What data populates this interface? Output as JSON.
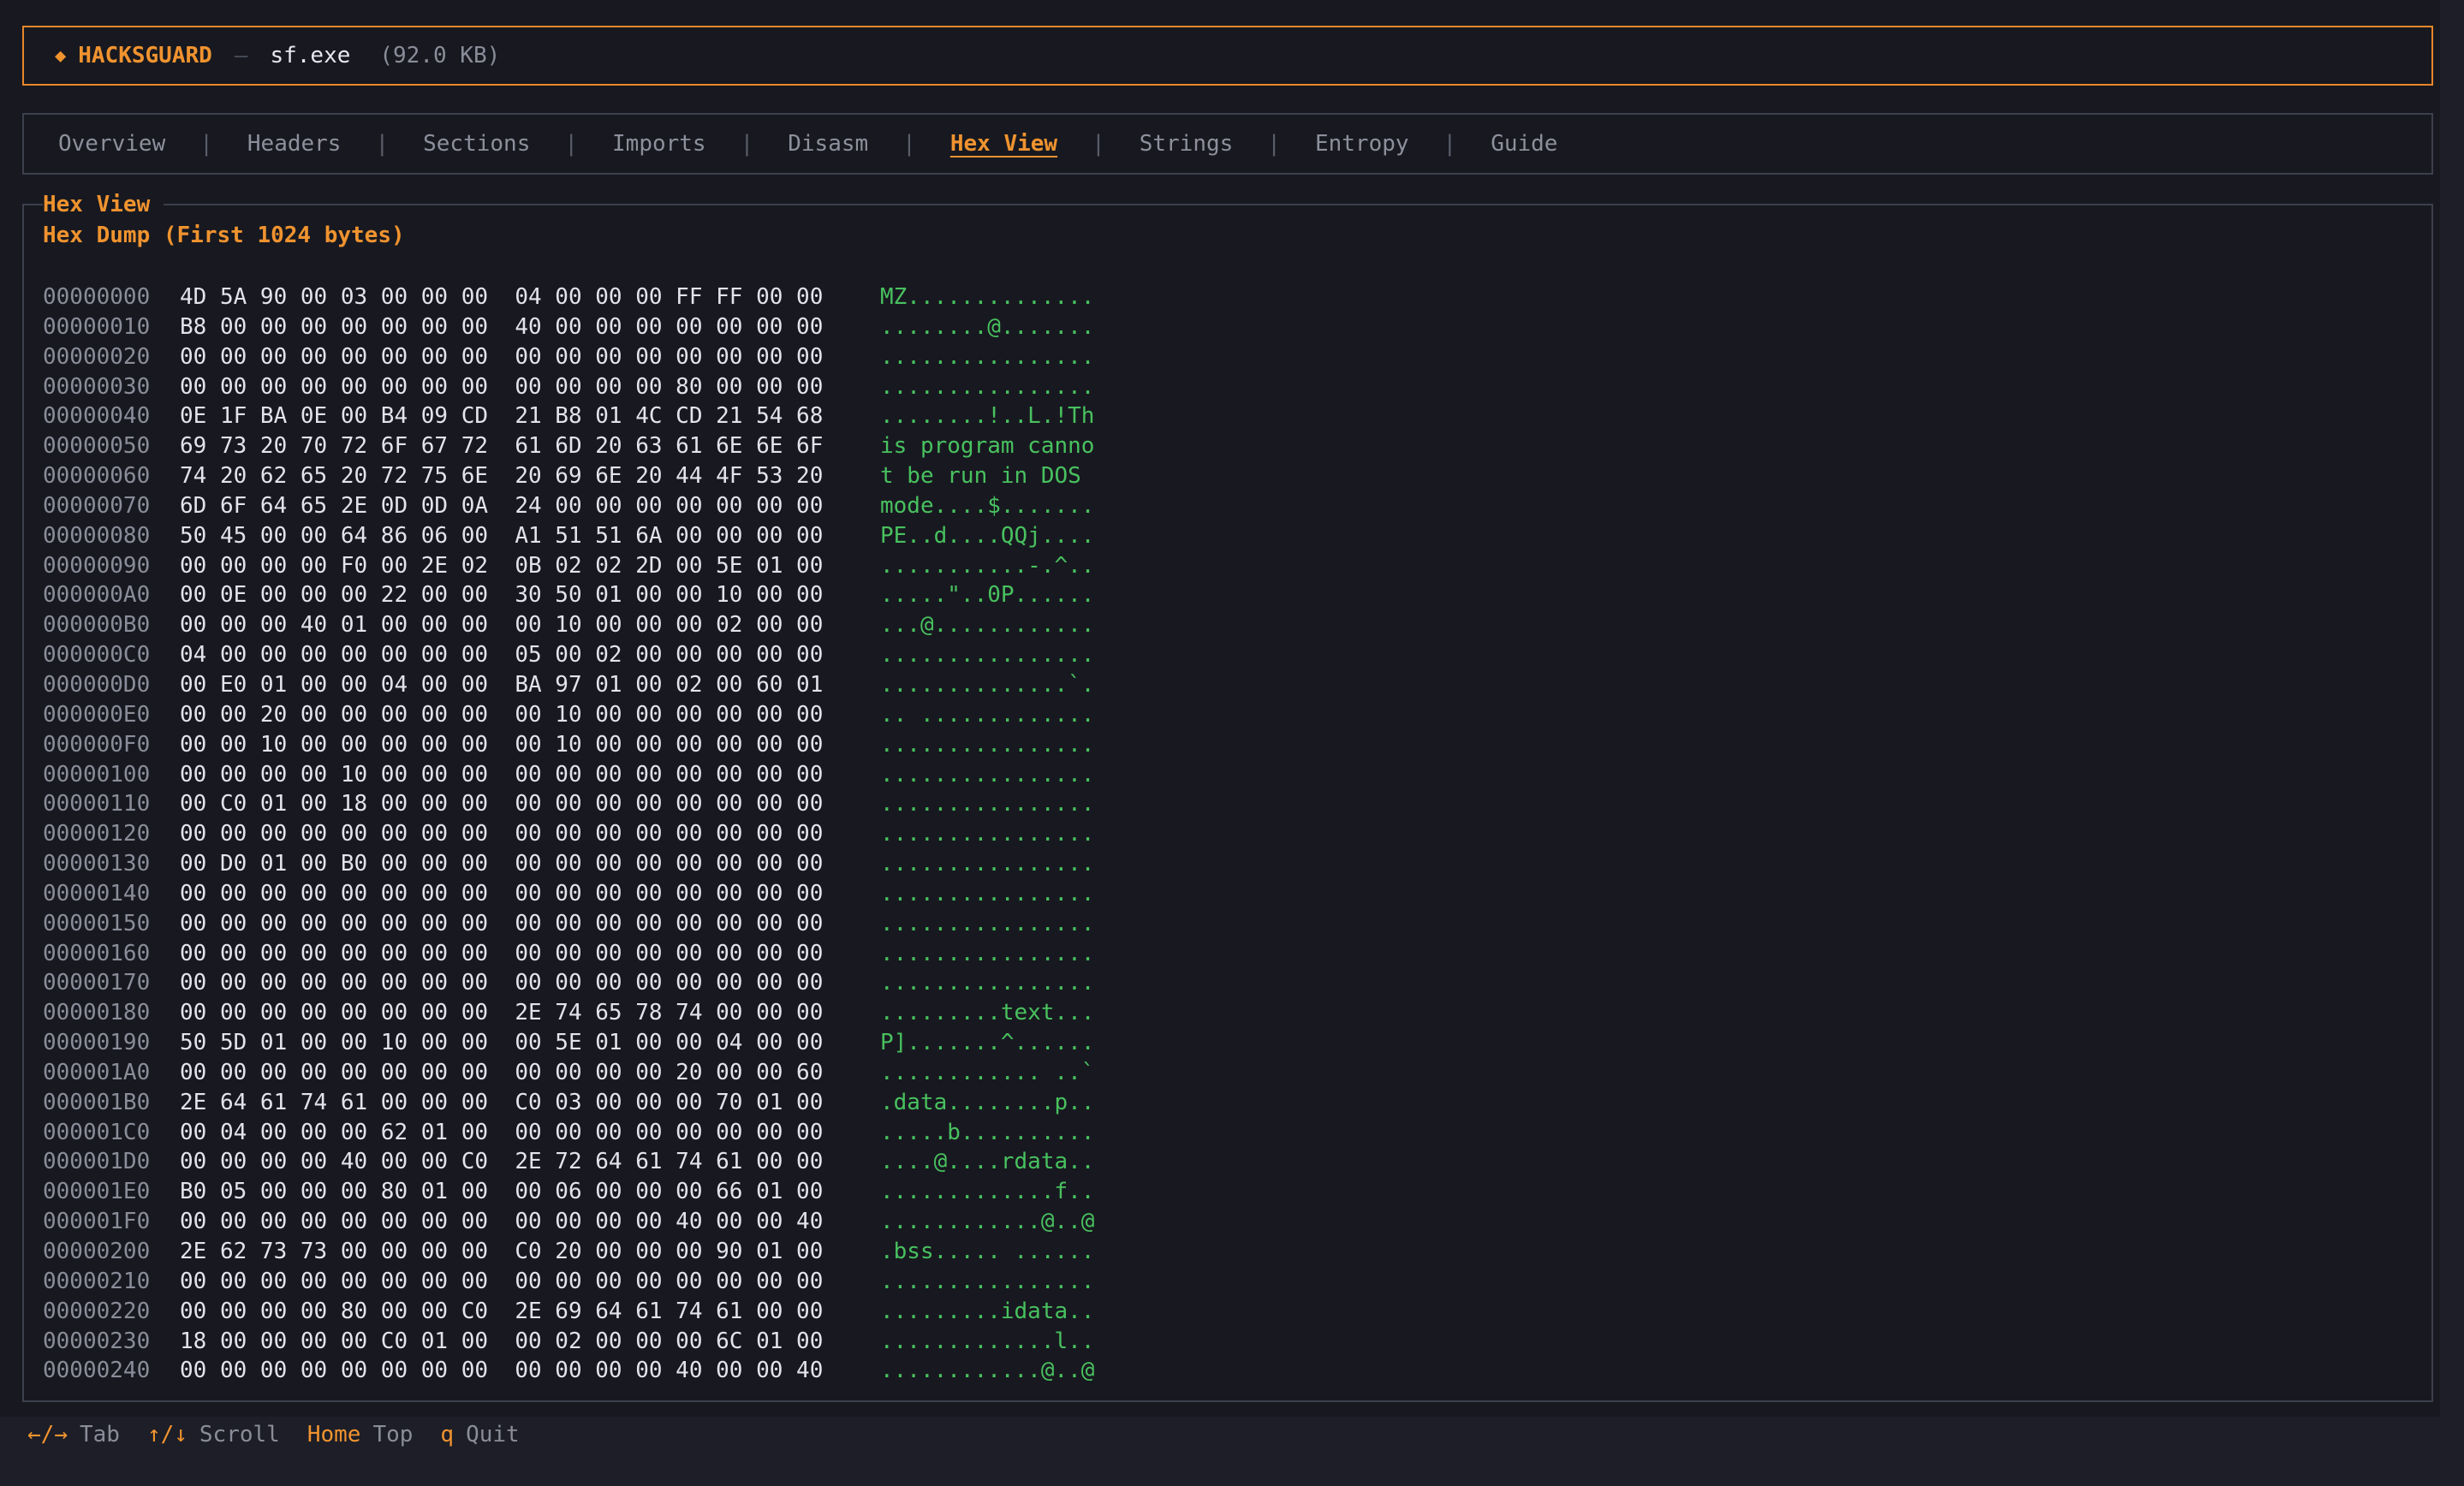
{
  "header": {
    "brand": "HACKSGUARD",
    "separator": "—",
    "filename": "sf.exe",
    "filesize": "(92.0 KB)"
  },
  "tabs": [
    {
      "id": "overview",
      "label": "Overview",
      "active": false
    },
    {
      "id": "headers",
      "label": "Headers",
      "active": false
    },
    {
      "id": "sections",
      "label": "Sections",
      "active": false
    },
    {
      "id": "imports",
      "label": "Imports",
      "active": false
    },
    {
      "id": "disasm",
      "label": "Disasm",
      "active": false
    },
    {
      "id": "hexview",
      "label": "Hex View",
      "active": true
    },
    {
      "id": "strings",
      "label": "Strings",
      "active": false
    },
    {
      "id": "entropy",
      "label": "Entropy",
      "active": false
    },
    {
      "id": "guide",
      "label": "Guide",
      "active": false
    }
  ],
  "content": {
    "legend": "Hex View",
    "subtitle": "Hex Dump (First 1024 bytes)"
  },
  "hex_rows": [
    {
      "offset": "00000000",
      "hex": "4D 5A 90 00 03 00 00 00  04 00 00 00 FF FF 00 00",
      "ascii": "MZ.............."
    },
    {
      "offset": "00000010",
      "hex": "B8 00 00 00 00 00 00 00  40 00 00 00 00 00 00 00",
      "ascii": "........@......."
    },
    {
      "offset": "00000020",
      "hex": "00 00 00 00 00 00 00 00  00 00 00 00 00 00 00 00",
      "ascii": "................"
    },
    {
      "offset": "00000030",
      "hex": "00 00 00 00 00 00 00 00  00 00 00 00 80 00 00 00",
      "ascii": "................"
    },
    {
      "offset": "00000040",
      "hex": "0E 1F BA 0E 00 B4 09 CD  21 B8 01 4C CD 21 54 68",
      "ascii": "........!..L.!Th"
    },
    {
      "offset": "00000050",
      "hex": "69 73 20 70 72 6F 67 72  61 6D 20 63 61 6E 6E 6F",
      "ascii": "is program canno"
    },
    {
      "offset": "00000060",
      "hex": "74 20 62 65 20 72 75 6E  20 69 6E 20 44 4F 53 20",
      "ascii": "t be run in DOS "
    },
    {
      "offset": "00000070",
      "hex": "6D 6F 64 65 2E 0D 0D 0A  24 00 00 00 00 00 00 00",
      "ascii": "mode....$......."
    },
    {
      "offset": "00000080",
      "hex": "50 45 00 00 64 86 06 00  A1 51 51 6A 00 00 00 00",
      "ascii": "PE..d....QQj...."
    },
    {
      "offset": "00000090",
      "hex": "00 00 00 00 F0 00 2E 02  0B 02 02 2D 00 5E 01 00",
      "ascii": "...........-.^.."
    },
    {
      "offset": "000000A0",
      "hex": "00 0E 00 00 00 22 00 00  30 50 01 00 00 10 00 00",
      "ascii": ".....\"..0P......"
    },
    {
      "offset": "000000B0",
      "hex": "00 00 00 40 01 00 00 00  00 10 00 00 00 02 00 00",
      "ascii": "...@............"
    },
    {
      "offset": "000000C0",
      "hex": "04 00 00 00 00 00 00 00  05 00 02 00 00 00 00 00",
      "ascii": "................"
    },
    {
      "offset": "000000D0",
      "hex": "00 E0 01 00 00 04 00 00  BA 97 01 00 02 00 60 01",
      "ascii": "..............`."
    },
    {
      "offset": "000000E0",
      "hex": "00 00 20 00 00 00 00 00  00 10 00 00 00 00 00 00",
      "ascii": ".. ............."
    },
    {
      "offset": "000000F0",
      "hex": "00 00 10 00 00 00 00 00  00 10 00 00 00 00 00 00",
      "ascii": "................"
    },
    {
      "offset": "00000100",
      "hex": "00 00 00 00 10 00 00 00  00 00 00 00 00 00 00 00",
      "ascii": "................"
    },
    {
      "offset": "00000110",
      "hex": "00 C0 01 00 18 00 00 00  00 00 00 00 00 00 00 00",
      "ascii": "................"
    },
    {
      "offset": "00000120",
      "hex": "00 00 00 00 00 00 00 00  00 00 00 00 00 00 00 00",
      "ascii": "................"
    },
    {
      "offset": "00000130",
      "hex": "00 D0 01 00 B0 00 00 00  00 00 00 00 00 00 00 00",
      "ascii": "................"
    },
    {
      "offset": "00000140",
      "hex": "00 00 00 00 00 00 00 00  00 00 00 00 00 00 00 00",
      "ascii": "................"
    },
    {
      "offset": "00000150",
      "hex": "00 00 00 00 00 00 00 00  00 00 00 00 00 00 00 00",
      "ascii": "................"
    },
    {
      "offset": "00000160",
      "hex": "00 00 00 00 00 00 00 00  00 00 00 00 00 00 00 00",
      "ascii": "................"
    },
    {
      "offset": "00000170",
      "hex": "00 00 00 00 00 00 00 00  00 00 00 00 00 00 00 00",
      "ascii": "................"
    },
    {
      "offset": "00000180",
      "hex": "00 00 00 00 00 00 00 00  2E 74 65 78 74 00 00 00",
      "ascii": ".........text..."
    },
    {
      "offset": "00000190",
      "hex": "50 5D 01 00 00 10 00 00  00 5E 01 00 00 04 00 00",
      "ascii": "P].......^......"
    },
    {
      "offset": "000001A0",
      "hex": "00 00 00 00 00 00 00 00  00 00 00 00 20 00 00 60",
      "ascii": "............ ..`"
    },
    {
      "offset": "000001B0",
      "hex": "2E 64 61 74 61 00 00 00  C0 03 00 00 00 70 01 00",
      "ascii": ".data........p.."
    },
    {
      "offset": "000001C0",
      "hex": "00 04 00 00 00 62 01 00  00 00 00 00 00 00 00 00",
      "ascii": ".....b.........."
    },
    {
      "offset": "000001D0",
      "hex": "00 00 00 00 40 00 00 C0  2E 72 64 61 74 61 00 00",
      "ascii": "....@....rdata.."
    },
    {
      "offset": "000001E0",
      "hex": "B0 05 00 00 00 80 01 00  00 06 00 00 00 66 01 00",
      "ascii": ".............f.."
    },
    {
      "offset": "000001F0",
      "hex": "00 00 00 00 00 00 00 00  00 00 00 00 40 00 00 40",
      "ascii": "............@..@"
    },
    {
      "offset": "00000200",
      "hex": "2E 62 73 73 00 00 00 00  C0 20 00 00 00 90 01 00",
      "ascii": ".bss..... ......"
    },
    {
      "offset": "00000210",
      "hex": "00 00 00 00 00 00 00 00  00 00 00 00 00 00 00 00",
      "ascii": "................"
    },
    {
      "offset": "00000220",
      "hex": "00 00 00 00 80 00 00 C0  2E 69 64 61 74 61 00 00",
      "ascii": ".........idata.."
    },
    {
      "offset": "00000230",
      "hex": "18 00 00 00 00 C0 01 00  00 02 00 00 00 6C 01 00",
      "ascii": ".............l.."
    },
    {
      "offset": "00000240",
      "hex": "00 00 00 00 00 00 00 00  00 00 00 00 40 00 00 40",
      "ascii": "............@..@"
    }
  ],
  "footer": {
    "hints": [
      {
        "key": "←/→",
        "desc": "Tab"
      },
      {
        "key": "↑/↓",
        "desc": "Scroll"
      },
      {
        "key": "Home",
        "desc": "Top"
      },
      {
        "key": "q",
        "desc": "Quit"
      }
    ]
  },
  "colors": {
    "accent": "#f0932f",
    "ascii_green": "#48c15f",
    "background": "#181920"
  }
}
